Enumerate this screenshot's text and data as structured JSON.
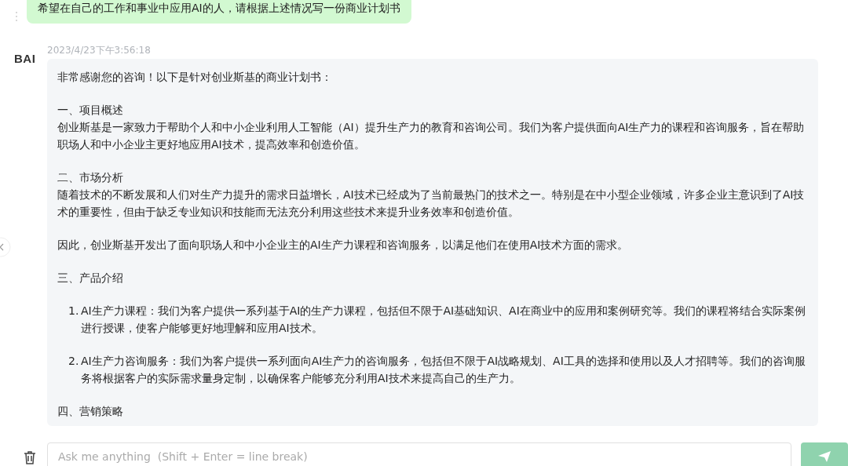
{
  "user_message": {
    "text": "希望在自己的工作和事业中应用AI的人，请根据上述情况写一份商业计划书"
  },
  "reply": {
    "avatar": "BAI",
    "timestamp": "2023/4/23下午3:56:18",
    "blocks": [
      {
        "kind": "para",
        "lines": [
          "非常感谢您的咨询！以下是针对创业斯基的商业计划书："
        ]
      },
      {
        "kind": "para",
        "lines": [
          "一、项目概述",
          "创业斯基是一家致力于帮助个人和中小企业利用人工智能（AI）提升生产力的教育和咨询公司。我们为客户提供面向AI生产力的课程和咨询服务，旨在帮助职场人和中小企业主更好地应用AI技术，提高效率和创造价值。"
        ]
      },
      {
        "kind": "para",
        "lines": [
          "二、市场分析",
          "随着技术的不断发展和人们对生产力提升的需求日益增长，AI技术已经成为了当前最热门的技术之一。特别是在中小型企业领域，许多企业主意识到了AI技术的重要性，但由于缺乏专业知识和技能而无法充分利用这些技术来提升业务效率和创造价值。"
        ]
      },
      {
        "kind": "para",
        "lines": [
          "因此，创业斯基开发出了面向职场人和中小企业主的AI生产力课程和咨询服务，以满足他们在使用AI技术方面的需求。"
        ]
      },
      {
        "kind": "para",
        "lines": [
          "三、产品介绍"
        ]
      },
      {
        "kind": "item",
        "number": "1.",
        "text": "AI生产力课程：我们为客户提供一系列基于AI的生产力课程，包括但不限于AI基础知识、AI在商业中的应用和案例研究等。我们的课程将结合实际案例进行授课，使客户能够更好地理解和应用AI技术。"
      },
      {
        "kind": "item",
        "number": "2.",
        "text": "AI生产力咨询服务：我们为客户提供一系列面向AI生产力的咨询服务，包括但不限于AI战略规划、AI工具的选择和使用以及人才招聘等。我们的咨询服务将根据客户的实际需求量身定制，以确保客户能够充分利用AI技术来提高自己的生产力。"
      },
      {
        "kind": "para",
        "lines": [
          "四、营销策略"
        ]
      }
    ]
  },
  "composer": {
    "placeholder": "Ask me anything  (Shift + Enter = line break)"
  }
}
